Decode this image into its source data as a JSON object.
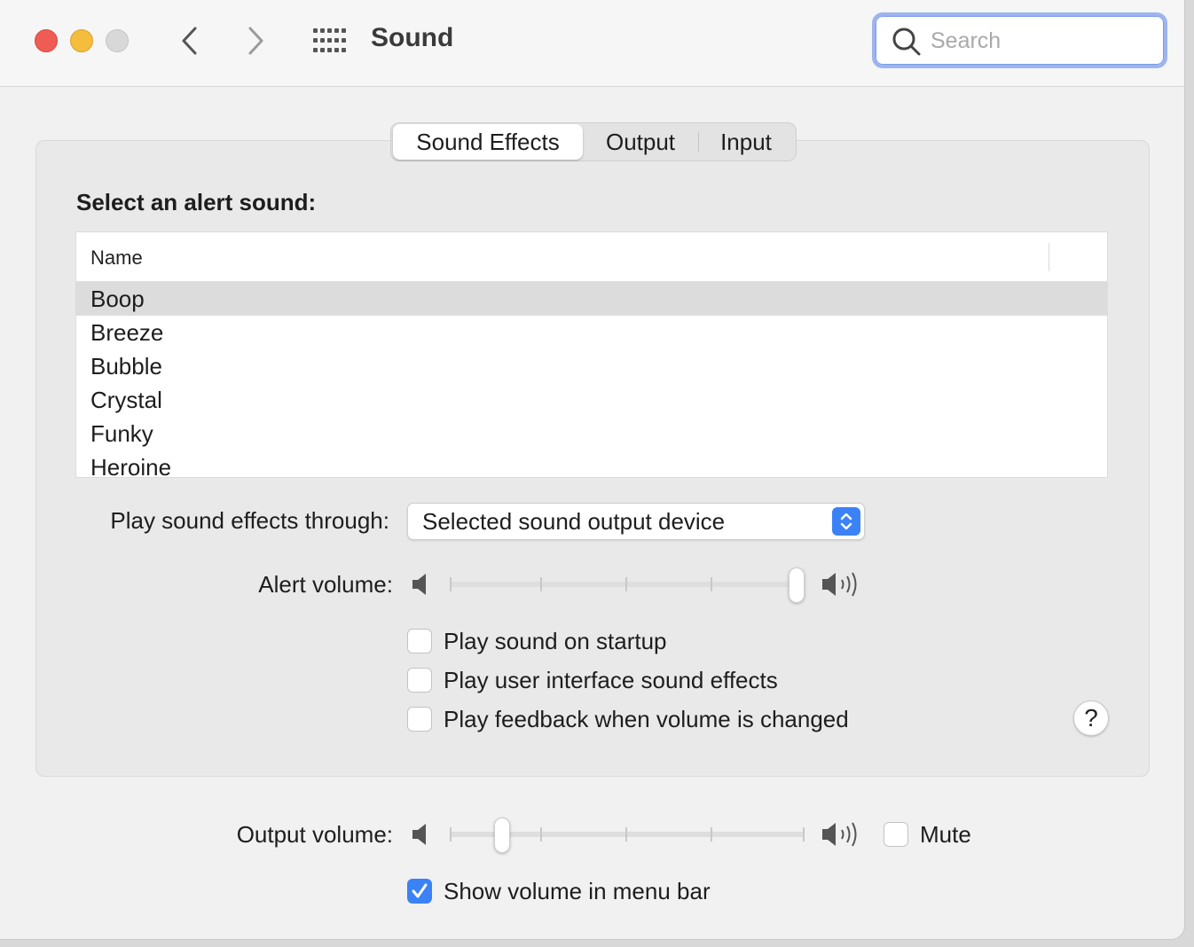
{
  "window": {
    "title": "Sound"
  },
  "search": {
    "placeholder": "Search",
    "value": ""
  },
  "tabs": [
    {
      "label": "Sound Effects",
      "selected": true
    },
    {
      "label": "Output",
      "selected": false
    },
    {
      "label": "Input",
      "selected": false
    }
  ],
  "sound_effects": {
    "heading": "Select an alert sound:",
    "table": {
      "column_name": "Name",
      "rows": [
        "Boop",
        "Breeze",
        "Bubble",
        "Crystal",
        "Funky",
        "Heroine"
      ],
      "selected": "Boop"
    },
    "play_through": {
      "label": "Play sound effects through:",
      "value": "Selected sound output device"
    },
    "alert_volume": {
      "label": "Alert volume:",
      "level": 1.0
    },
    "checkboxes": [
      {
        "label": "Play sound on startup",
        "checked": false
      },
      {
        "label": "Play user interface sound effects",
        "checked": false
      },
      {
        "label": "Play feedback when volume is changed",
        "checked": false
      }
    ],
    "help": "?"
  },
  "output": {
    "volume_label": "Output volume:",
    "volume_level": 0.13,
    "mute_label": "Mute",
    "mute_checked": false,
    "show_in_menu_bar_label": "Show volume in menu bar",
    "show_in_menu_bar_checked": true
  },
  "colors": {
    "accent": "#3b82f6",
    "close": "#ee5c54",
    "minimize": "#f4bd3e",
    "zoom_disabled": "#d8d8d8"
  },
  "icons": [
    "back-chevron-icon",
    "forward-chevron-icon",
    "grid-icon",
    "search-icon",
    "speaker-low-icon",
    "speaker-high-icon",
    "checkmark-icon",
    "stepper-icon"
  ]
}
